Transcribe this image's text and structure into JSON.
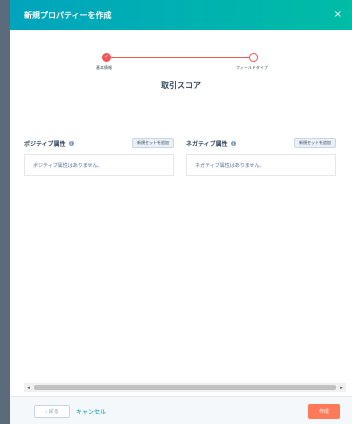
{
  "header": {
    "title": "新規プロパティーを作成",
    "close_icon": "×"
  },
  "stepper": {
    "steps": [
      {
        "label": "基本情報",
        "state": "done"
      },
      {
        "label": "フィールドタイプ",
        "state": "todo"
      }
    ],
    "accent": "#f2545b"
  },
  "section_title": "取引スコア",
  "positive": {
    "title": "ポジティブ属性",
    "add_label": "新規セットを追加",
    "empty_text": "ポジティブ属性はありません。"
  },
  "negative": {
    "title": "ネガティブ属性",
    "add_label": "新規セットを追加",
    "empty_text": "ネガティブ属性はありません。"
  },
  "footer": {
    "back_label": "‹ 戻る",
    "cancel_label": "キャンセル",
    "create_label": "作成"
  },
  "colors": {
    "header_start": "#00a4bd",
    "header_end": "#00bda5",
    "primary_button": "#ff7a59",
    "link": "#0091ae"
  }
}
